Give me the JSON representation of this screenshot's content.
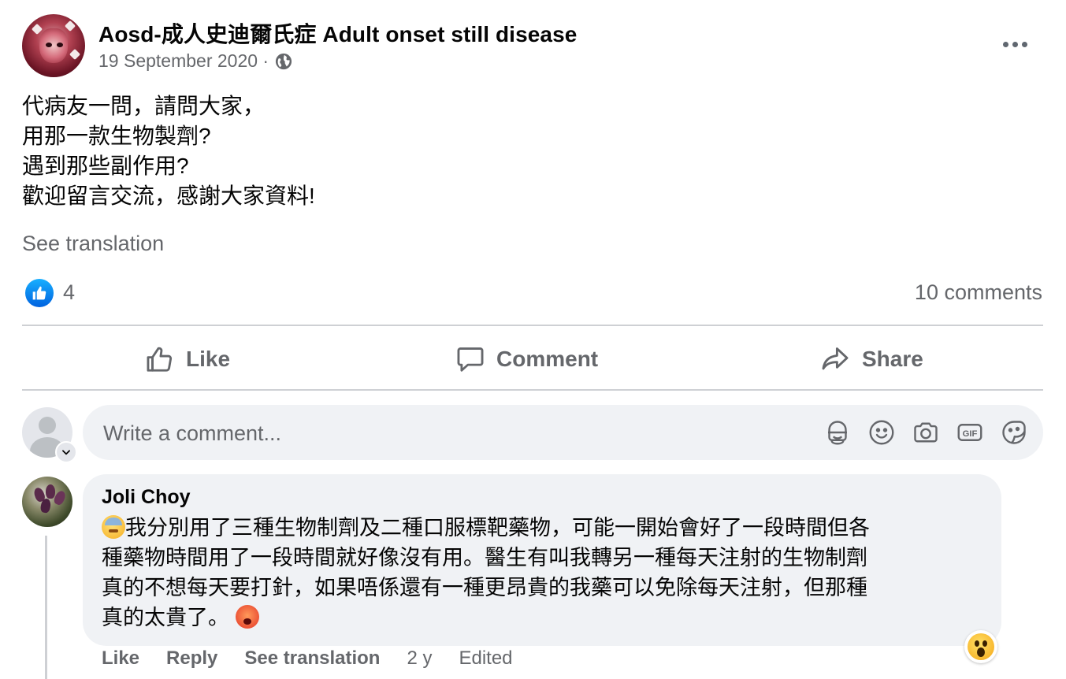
{
  "post": {
    "group_name": "Aosd-成人史迪爾氏症 Adult onset still disease",
    "date": "19 September 2020 ·",
    "body_lines": [
      "代病友一問，請問大家，",
      "用那一款生物製劑?",
      "遇到那些副作用?",
      "歡迎留言交流，感謝大家資料!"
    ],
    "see_translation": "See translation",
    "reaction_count": "4",
    "comments_count": "10 comments"
  },
  "actions": {
    "like": "Like",
    "comment": "Comment",
    "share": "Share"
  },
  "composer": {
    "placeholder": "Write a comment...",
    "icons": [
      "avatar-sticker-icon",
      "emoji-icon",
      "camera-icon",
      "gif-icon",
      "sticker-icon"
    ]
  },
  "comment": {
    "author": "Joli Choy",
    "lines": [
      "我分別用了三種生物制劑及二種口服標靶藥物，可能一開始會好了一段時間但各",
      "種藥物時間用了一段時間就好像沒有用。醫生有叫我轉另一種每天注射的生物制劑",
      "真的不想每天要打針，如果唔係還有一種更昂貴的我藥可以免除每天注射，但那種",
      "真的太貴了。"
    ],
    "reaction": "wow-icon",
    "actions": {
      "like": "Like",
      "reply": "Reply",
      "see_translation": "See translation",
      "time": "2 y",
      "edited": "Edited"
    }
  },
  "colors": {
    "text_primary": "#050505",
    "text_secondary": "#65676b",
    "bubble_bg": "#f0f2f5",
    "divider": "#ced0d4",
    "like_blue": "#0062df"
  }
}
